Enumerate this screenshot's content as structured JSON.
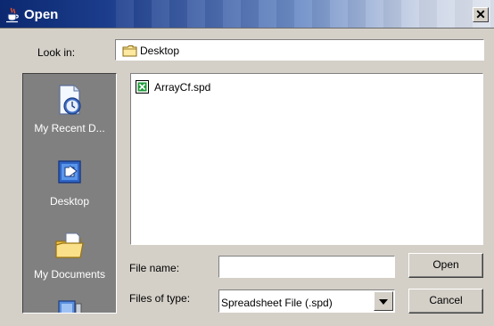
{
  "window": {
    "title": "Open",
    "close_glyph": "✕"
  },
  "look_in": {
    "label": "Look in:",
    "value": "Desktop",
    "icon": "folder-icon"
  },
  "places": [
    {
      "label": "My Recent D...",
      "icon": "recent-documents-icon"
    },
    {
      "label": "Desktop",
      "icon": "desktop-icon"
    },
    {
      "label": "My Documents",
      "icon": "my-documents-icon"
    },
    {
      "label": "",
      "icon": "my-computer-icon"
    }
  ],
  "files": [
    {
      "name": "ArrayCf.spd",
      "icon": "spreadsheet-file-icon"
    }
  ],
  "file_name": {
    "label": "File name:",
    "value": ""
  },
  "file_type": {
    "label": "Files of type:",
    "value": "Spreadsheet File (.spd)"
  },
  "buttons": {
    "open": "Open",
    "cancel": "Cancel"
  },
  "colors": {
    "title_start": "#0b2870",
    "title_end": "#dfe4ee",
    "dialog_bg": "#d4d0c8",
    "places_bg": "#808080"
  }
}
